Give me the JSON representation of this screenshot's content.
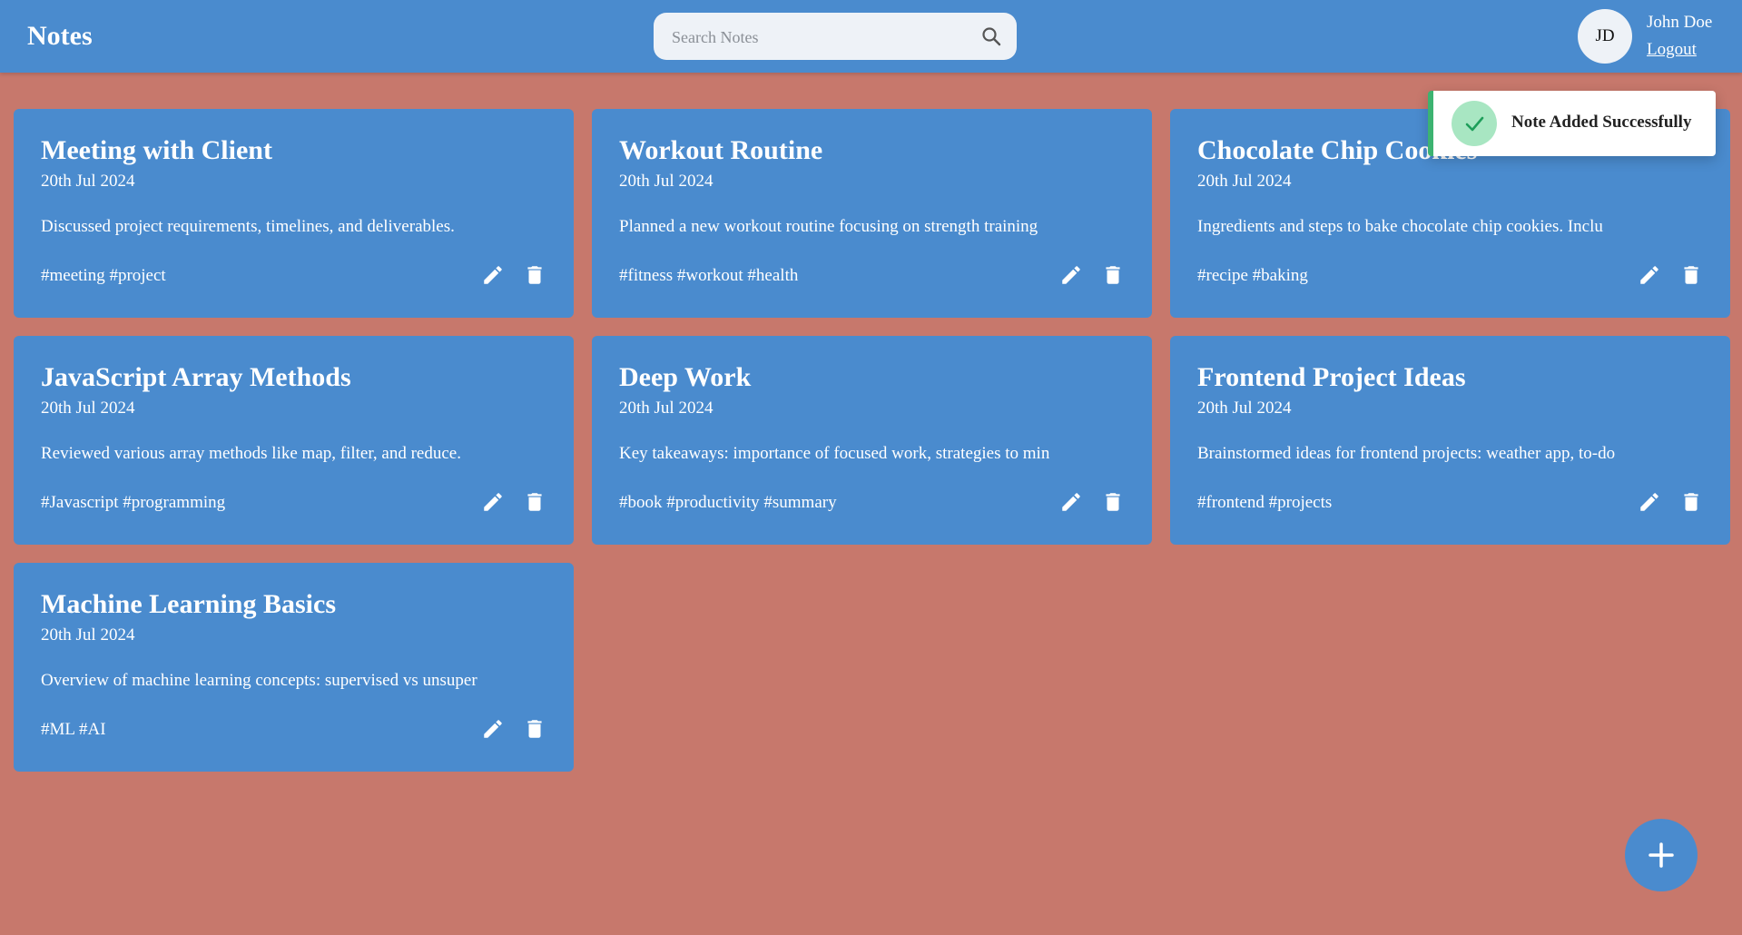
{
  "app": {
    "brand": "Notes"
  },
  "search": {
    "placeholder": "Search Notes",
    "value": ""
  },
  "user": {
    "initials": "JD",
    "name": "John Doe",
    "logout_label": "Logout"
  },
  "toast": {
    "message": "Note Added Successfully"
  },
  "notes": [
    {
      "title": "Meeting with Client",
      "date": "20th Jul 2024",
      "content": "Discussed project requirements, timelines, and deliverables.",
      "tags": "#meeting #project"
    },
    {
      "title": "Workout Routine",
      "date": "20th Jul 2024",
      "content": "Planned a new workout routine focusing on strength training",
      "tags": "#fitness #workout #health"
    },
    {
      "title": "Chocolate Chip Cookies",
      "date": "20th Jul 2024",
      "content": "Ingredients and steps to bake chocolate chip cookies. Inclu",
      "tags": "#recipe #baking"
    },
    {
      "title": "JavaScript Array Methods",
      "date": "20th Jul 2024",
      "content": "Reviewed various array methods like map, filter, and reduce.",
      "tags": "#Javascript #programming"
    },
    {
      "title": "Deep Work",
      "date": "20th Jul 2024",
      "content": "Key takeaways: importance of focused work, strategies to min",
      "tags": "#book #productivity #summary"
    },
    {
      "title": "Frontend Project Ideas",
      "date": "20th Jul 2024",
      "content": "Brainstormed ideas for frontend projects: weather app, to-do",
      "tags": "#frontend #projects"
    },
    {
      "title": "Machine Learning Basics",
      "date": "20th Jul 2024",
      "content": "Overview of machine learning concepts: supervised vs unsuper",
      "tags": "#ML #AI"
    }
  ],
  "colors": {
    "background": "#c7786c",
    "primary": "#4a8bce",
    "toast_accent": "#3cb371",
    "toast_check_bg": "#a8e6c2"
  },
  "icons": {
    "search": "search-icon",
    "edit": "pencil-icon",
    "delete": "trash-icon",
    "success": "check-icon",
    "add": "plus-icon"
  }
}
